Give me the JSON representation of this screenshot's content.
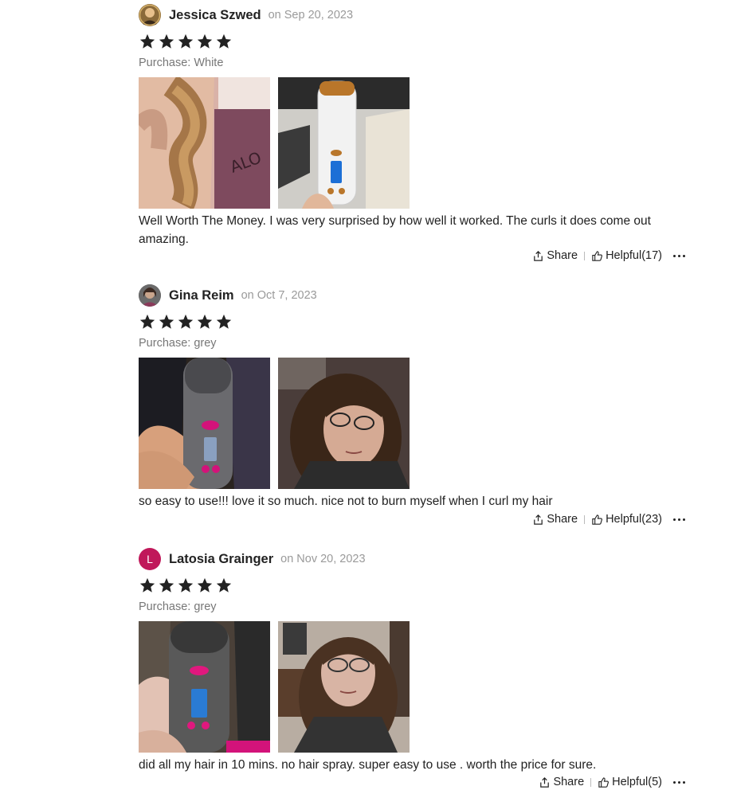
{
  "reviews": [
    {
      "name": "Jessica Szwed",
      "date": "on Sep 20, 2023",
      "rating": 5,
      "purchase": "Purchase: White",
      "text": "Well Worth The Money. I was very surprised by how well it worked. The curls it does come out amazing.",
      "share_label": "Share",
      "helpful_label": "Helpful(17)",
      "avatar_letter": ""
    },
    {
      "name": "Gina Reim",
      "date": "on Oct 7, 2023",
      "rating": 5,
      "purchase": "Purchase: grey",
      "text": "so easy to use!!! love it so much. nice not to burn myself when I curl my hair",
      "share_label": "Share",
      "helpful_label": "Helpful(23)",
      "avatar_letter": ""
    },
    {
      "name": "Latosia Grainger",
      "date": "on Nov 20, 2023",
      "rating": 5,
      "purchase": "Purchase: grey",
      "text": "did all my hair in 10 mins. no hair spray. super easy to use . worth the price for sure.",
      "share_label": "Share",
      "helpful_label": "Helpful(5)",
      "avatar_letter": "L"
    }
  ],
  "colors": {
    "star": "#222222",
    "muted": "#9a9a9a",
    "avatar_accent": "#c0185a"
  },
  "icons": {
    "rating": "star-icon",
    "share": "share-icon",
    "helpful": "thumbs-up-icon",
    "more": "more-dots-icon"
  }
}
